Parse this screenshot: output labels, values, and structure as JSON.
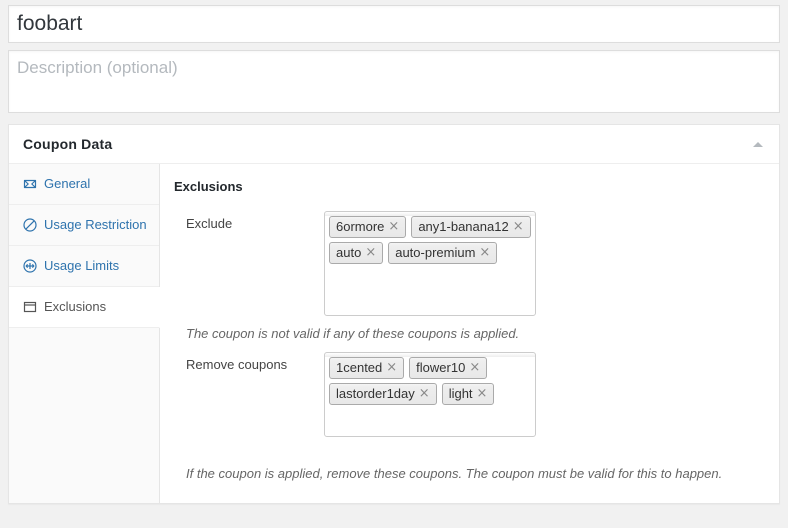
{
  "post": {
    "title_value": "foobart",
    "description_placeholder": "Description (optional)",
    "description_value": ""
  },
  "metabox": {
    "title": "Coupon Data",
    "toggle_label": "Toggle panel"
  },
  "tabs": [
    {
      "id": "general",
      "label": "General",
      "icon": "ticket-icon",
      "active": false
    },
    {
      "id": "usage-restriction",
      "label": "Usage Restriction",
      "icon": "no-entry-icon",
      "active": false
    },
    {
      "id": "usage-limits",
      "label": "Usage Limits",
      "icon": "usage-limits-icon",
      "active": false
    },
    {
      "id": "exclusions",
      "label": "Exclusions",
      "icon": "window-icon",
      "active": true
    }
  ],
  "panel": {
    "heading": "Exclusions",
    "fields": [
      {
        "id": "exclude-coupons",
        "label": "Exclude",
        "tags": [
          "6ormore",
          "any1-banana12",
          "auto",
          "auto-premium"
        ],
        "remove_glyph": "×",
        "help": "The coupon is not valid if any of these coupons is applied."
      },
      {
        "id": "remove-coupons",
        "label": "Remove coupons",
        "tags": [
          "1cented",
          "flower10",
          "lastorder1day",
          "light"
        ],
        "remove_glyph": "×",
        "help": "If the coupon is applied, remove these coupons. The coupon must be valid for this to happen."
      }
    ]
  },
  "colors": {
    "page_background": "#f1f1f1",
    "panel_background": "#ffffff",
    "panel_border": "#e5e5e5",
    "tab_link": "#2e73ad",
    "tab_active_text": "#555555",
    "chip_border": "#aaaaaa",
    "chip_background": "#eeeeee",
    "help_text": "#666666"
  }
}
